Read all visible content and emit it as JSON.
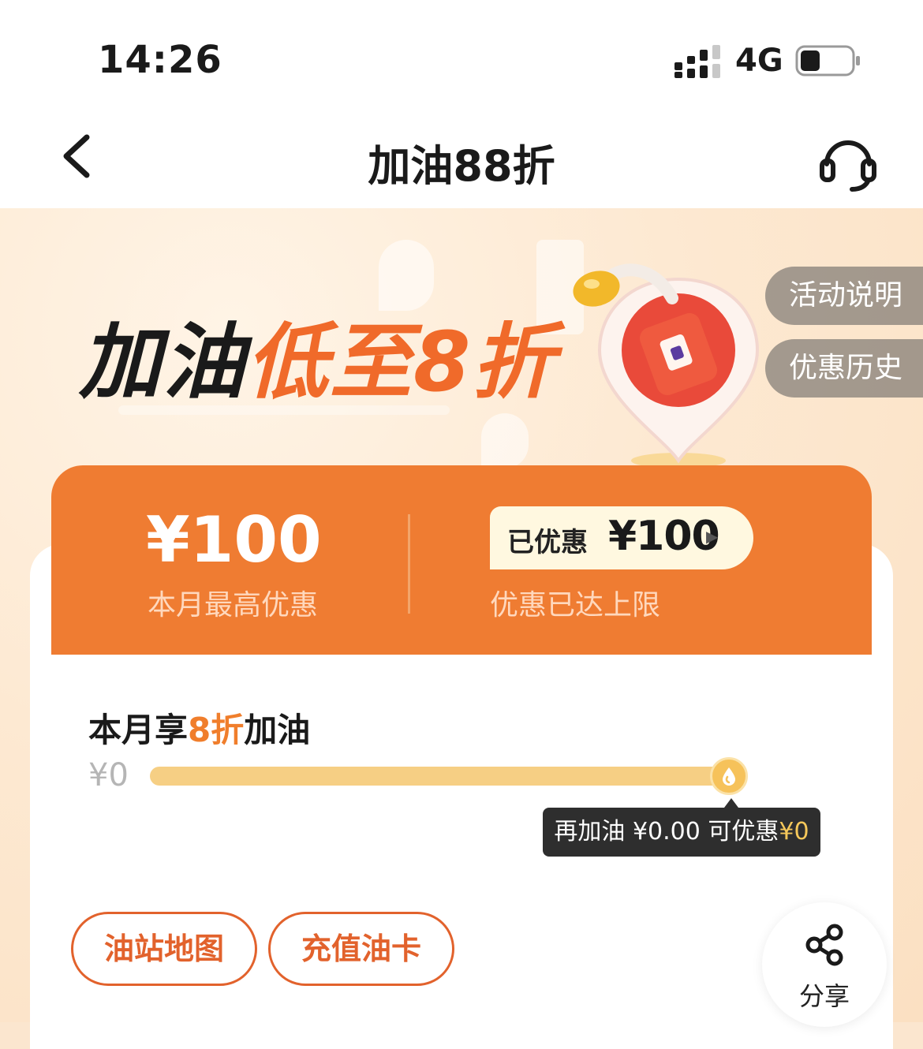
{
  "status_bar": {
    "time": "14:26",
    "network": "4G"
  },
  "nav": {
    "title": "加油88折"
  },
  "banner": {
    "headline_dark": "加油",
    "headline_orange": "低至8折",
    "side_buttons": [
      "活动说明",
      "优惠历史"
    ]
  },
  "promo": {
    "max_amount": "¥100",
    "max_label": "本月最高优惠",
    "saved_label": "已优惠",
    "saved_value": "¥100",
    "limit_text": "优惠已达上限"
  },
  "progress": {
    "title_prefix": "本月享",
    "title_highlight": "8折",
    "title_suffix": "加油",
    "start_label": "¥0",
    "fill_fraction": 1.0,
    "tooltip_prefix": "再加油 ¥0.00 可优惠",
    "tooltip_amount": "¥0"
  },
  "actions": {
    "station_map": "油站地图",
    "recharge_card": "充值油卡",
    "share": "分享"
  },
  "colors": {
    "accent": "#ef7c32",
    "button_border": "#e2622c",
    "progress": "#f6cf84"
  }
}
